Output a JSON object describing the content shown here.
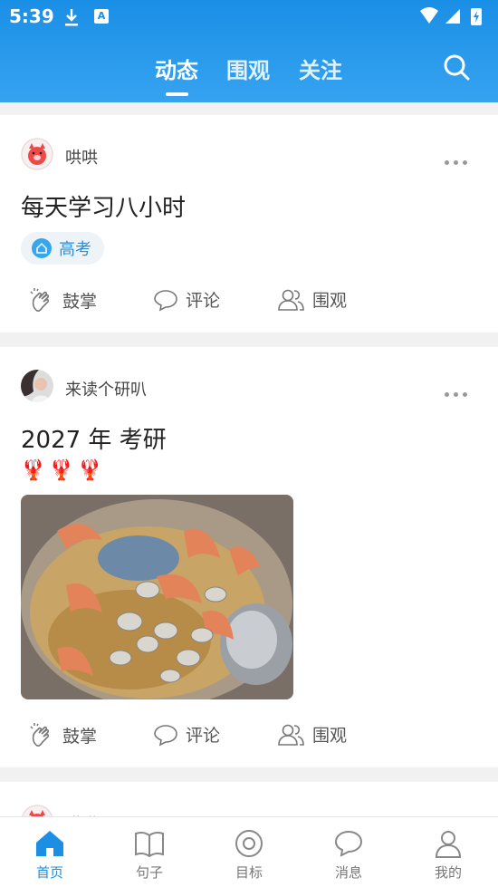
{
  "status_bar": {
    "time": "5:39",
    "app_icon_letter": "A"
  },
  "tabs": [
    {
      "label": "动态",
      "active": true
    },
    {
      "label": "围观",
      "active": false
    },
    {
      "label": "关注",
      "active": false
    }
  ],
  "posts": [
    {
      "author": "哄哄",
      "title": "每天学习八小时",
      "tag": "高考",
      "actions": {
        "clap": "鼓掌",
        "comment": "评论",
        "watch": "围观"
      }
    },
    {
      "author": "来读个研叭",
      "title": "2027 年 考研",
      "emojis": "🦞🦞🦞",
      "actions": {
        "clap": "鼓掌",
        "comment": "评论",
        "watch": "围观"
      }
    },
    {
      "author": "哄哄"
    }
  ],
  "bottom_nav": [
    {
      "label": "首页",
      "icon": "home-icon",
      "active": true
    },
    {
      "label": "句子",
      "icon": "book-icon",
      "active": false
    },
    {
      "label": "目标",
      "icon": "target-icon",
      "active": false
    },
    {
      "label": "消息",
      "icon": "message-icon",
      "active": false
    },
    {
      "label": "我的",
      "icon": "user-icon",
      "active": false
    }
  ],
  "colors": {
    "primary": "#1c8fe5",
    "header_top": "#1a8fe6",
    "header_bottom": "#36a3f0"
  }
}
